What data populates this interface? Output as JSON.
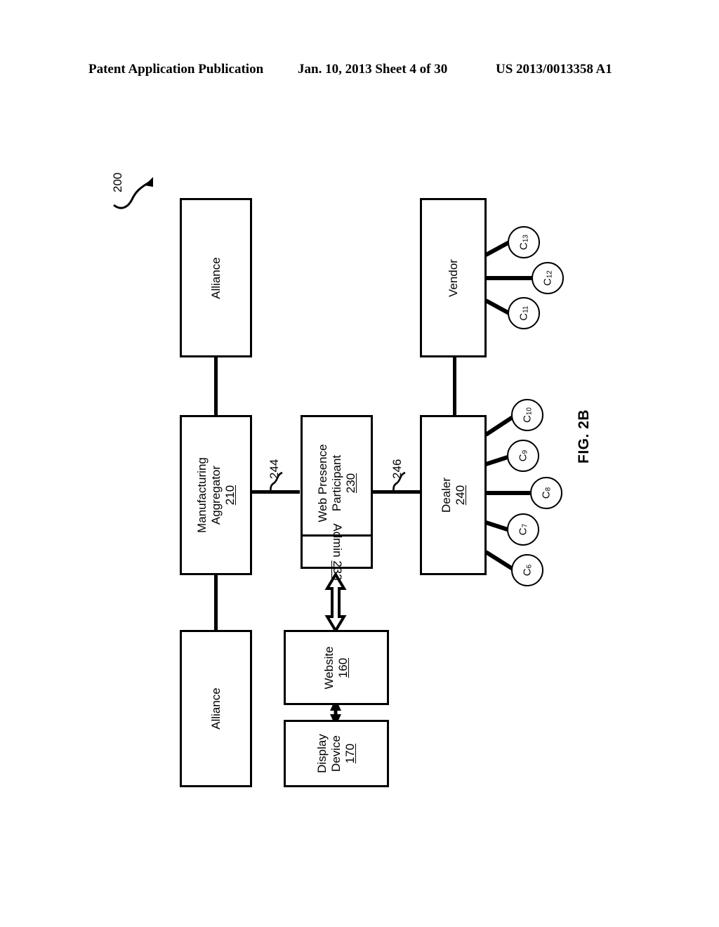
{
  "header": {
    "left": "Patent Application Publication",
    "middle": "Jan. 10, 2013  Sheet 4 of 30",
    "right": "US 2013/0013358 A1"
  },
  "figure": {
    "label": "FIG. 2B",
    "system_ref": "200"
  },
  "diagram": {
    "boxes": [
      {
        "id": "alliance_top",
        "label": "Alliance",
        "ref": ""
      },
      {
        "id": "alliance_bot",
        "label": "Alliance",
        "ref": ""
      },
      {
        "id": "manufacturing",
        "line1": "Manufacturing",
        "line2": "Aggregator",
        "ref": "210"
      },
      {
        "id": "webpresence",
        "line1": "Web Presence",
        "line2": "Participant",
        "ref": "230"
      },
      {
        "id": "admin",
        "label": "Admin",
        "ref": "233"
      },
      {
        "id": "vendor",
        "label": "Vendor",
        "ref": ""
      },
      {
        "id": "dealer",
        "label": "Dealer",
        "ref": "240"
      },
      {
        "id": "website",
        "label": "Website",
        "ref": "160"
      },
      {
        "id": "display",
        "line1": "Display",
        "line2": "Device",
        "ref": "170"
      }
    ],
    "connectors": [
      {
        "id": "conn_244",
        "ref": "244",
        "from": "manufacturing",
        "to": "webpresence"
      },
      {
        "id": "conn_246",
        "ref": "246",
        "from": "webpresence",
        "to": "dealer"
      }
    ],
    "vendor_clients": [
      {
        "id": "c11",
        "prefix": "C",
        "sub": "11"
      },
      {
        "id": "c12",
        "prefix": "C",
        "sub": "12"
      },
      {
        "id": "c13",
        "prefix": "C",
        "sub": "13"
      }
    ],
    "dealer_clients": [
      {
        "id": "c6",
        "prefix": "C",
        "sub": "6"
      },
      {
        "id": "c7",
        "prefix": "C",
        "sub": "7"
      },
      {
        "id": "c8",
        "prefix": "C",
        "sub": "8"
      },
      {
        "id": "c9",
        "prefix": "C",
        "sub": "9"
      },
      {
        "id": "c10",
        "prefix": "C",
        "sub": "10"
      }
    ]
  }
}
